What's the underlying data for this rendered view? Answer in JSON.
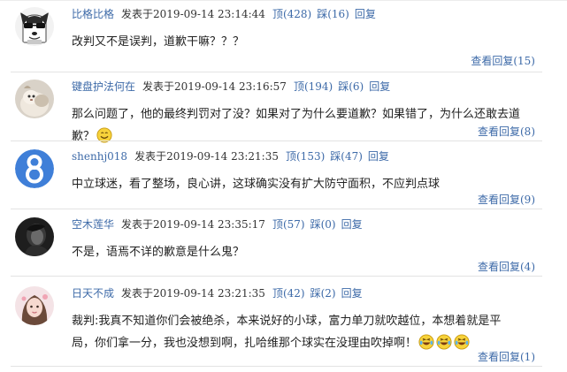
{
  "labels": {
    "posted_at": "发表于",
    "up": "顶",
    "down": "踩",
    "reply": "回复",
    "view_replies": "查看回复"
  },
  "comments": [
    {
      "user": "比格比格",
      "time": "2019-09-14  23:14:44",
      "up_text": "顶(428)",
      "down_text": "踩(16)",
      "reply_text": "回复",
      "text": "改判又不是误判，道歉干嘛？？？",
      "view_replies_text": "查看回复(15)",
      "avatar_icon": "husky-avatar-icon"
    },
    {
      "user": "键盘护法何在",
      "time": "2019-09-14  23:16:57",
      "up_text": "顶(194)",
      "down_text": "踩(6)",
      "reply_text": "回复",
      "text": "那么问题了，他的最终判罚对了没？如果对了为什么要道歉？如果错了，为什么还敢去道歉？",
      "view_replies_text": "查看回复(8)",
      "avatar_icon": "animal-photo-avatar-icon",
      "emoji_icons": [
        "smile-emoji-icon"
      ]
    },
    {
      "user": "shenhj018",
      "time": "2019-09-14  23:21:35",
      "up_text": "顶(153)",
      "down_text": "踩(47)",
      "reply_text": "回复",
      "text": "中立球迷，看了整场，良心讲，这球确实没有扩大防守面积，不应判点球",
      "view_replies_text": "查看回复(9)",
      "avatar_icon": "number-eight-avatar-icon"
    },
    {
      "user": "空木莲华",
      "time": "2019-09-14  23:35:17",
      "up_text": "顶(57)",
      "down_text": "踩(0)",
      "reply_text": "回复",
      "text": "不是，语焉不详的歉意是什么鬼？",
      "view_replies_text": "查看回复(4)",
      "avatar_icon": "dark-portrait-avatar-icon"
    },
    {
      "user": "日天不成",
      "time": "2019-09-14  23:21:35",
      "up_text": "顶(42)",
      "down_text": "踩(2)",
      "reply_text": "回复",
      "text": "裁判:我真不知道你们会被绝杀，本来说好的小球，富力单刀就吹越位，本想着就是平局，你们拿一分，我也没想到啊，扎哈维那个球实在没理由吹掉啊！",
      "view_replies_text": "查看回复(1)",
      "avatar_icon": "girl-portrait-avatar-icon",
      "emoji_icons": [
        "laugh-cry-emoji-icon",
        "laugh-cry-emoji-icon",
        "laugh-cry-emoji-icon"
      ]
    }
  ],
  "colors": {
    "link": "#3d6aa8",
    "text": "#222222",
    "meta_text": "#333333",
    "separator": "#e3e3e3",
    "emoji": "#f5c518"
  }
}
